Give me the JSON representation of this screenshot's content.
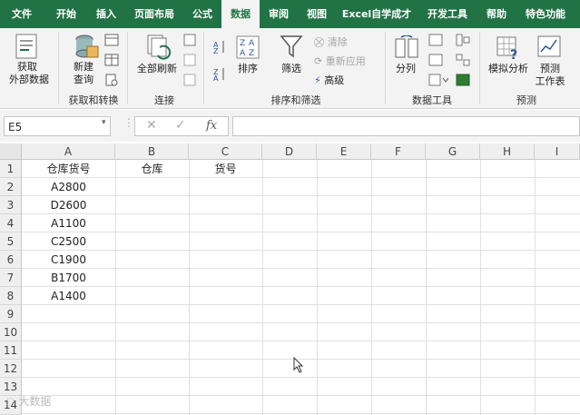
{
  "tabs": [
    "文件",
    "开始",
    "插入",
    "页面布局",
    "公式",
    "数据",
    "审阅",
    "视图",
    "Excel自学成才",
    "开发工具",
    "帮助",
    "特色功能"
  ],
  "active_tab": "数据",
  "ribbon": {
    "get_data": [
      "获取",
      "外部数据"
    ],
    "new_query": [
      "新建",
      "查询"
    ],
    "group_get_transform": "获取和转换",
    "refresh_all": "全部刷新",
    "group_connections": "连接",
    "sort": "排序",
    "filter": "筛选",
    "clear": "清除",
    "reapply": "重新应用",
    "advanced": "高级",
    "group_sort_filter": "排序和筛选",
    "text_to_columns": "分列",
    "group_data_tools": "数据工具",
    "what_if": "模拟分析",
    "forecast_sheet": [
      "预测",
      "工作表"
    ],
    "group_forecast": "预测"
  },
  "formula_bar": {
    "name_box": "E5",
    "fx": "fx",
    "formula": ""
  },
  "columns": [
    "A",
    "B",
    "C",
    "D",
    "E",
    "F",
    "G",
    "H",
    "I"
  ],
  "rows": [
    "1",
    "2",
    "3",
    "4",
    "5",
    "6",
    "7",
    "8",
    "9",
    "10",
    "11",
    "12",
    "13",
    "14"
  ],
  "cells": {
    "A1": "仓库货号",
    "B1": "仓库",
    "C1": "货号",
    "A2": "A2800",
    "A3": "D2600",
    "A4": "A1100",
    "A5": "C2500",
    "A6": "C1900",
    "A7": "B1700",
    "A8": "A1400"
  },
  "watermark": "大数据"
}
